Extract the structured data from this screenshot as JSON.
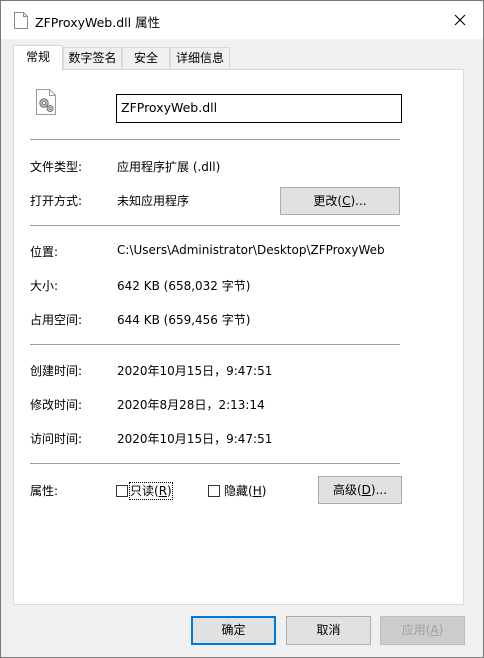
{
  "window": {
    "title": "ZFProxyWeb.dll 属性",
    "close_glyph": "✕"
  },
  "tabs": [
    {
      "label": "常规",
      "active": true
    },
    {
      "label": "数字签名",
      "active": false
    },
    {
      "label": "安全",
      "active": false
    },
    {
      "label": "详细信息",
      "active": false
    }
  ],
  "general": {
    "file_name": "ZFProxyWeb.dll",
    "file_icon": "dll-file-icon",
    "type_label": "文件类型:",
    "type_value": "应用程序扩展 (.dll)",
    "opens_with_label": "打开方式:",
    "opens_with_value": "未知应用程序",
    "change_button": {
      "prefix": "更改(",
      "hotkey": "C",
      "suffix": ")..."
    },
    "location_label": "位置:",
    "location_value": "C:\\Users\\Administrator\\Desktop\\ZFProxyWeb",
    "size_label": "大小:",
    "size_value": "642 KB (658,032 字节)",
    "disk_size_label": "占用空间:",
    "disk_size_value": "644 KB (659,456 字节)",
    "created_label": "创建时间:",
    "created_value": "2020年10月15日，9:47:51",
    "modified_label": "修改时间:",
    "modified_value": "2020年8月28日，2:13:14",
    "accessed_label": "访问时间:",
    "accessed_value": "2020年10月15日，9:47:51",
    "attributes_label": "属性:",
    "readonly": {
      "prefix": "只读(",
      "hotkey": "R",
      "suffix": ")",
      "checked": false
    },
    "hidden": {
      "prefix": "隐藏(",
      "hotkey": "H",
      "suffix": ")",
      "checked": false
    },
    "advanced_button": {
      "prefix": "高级(",
      "hotkey": "D",
      "suffix": ")..."
    }
  },
  "footer": {
    "ok": "确定",
    "cancel": "取消",
    "apply": {
      "prefix": "应用(",
      "hotkey": "A",
      "suffix": ")",
      "enabled": false
    }
  },
  "colors": {
    "default_button_border": "#0078d7",
    "panel_background": "#ffffff",
    "window_background": "#f0f0f0"
  }
}
